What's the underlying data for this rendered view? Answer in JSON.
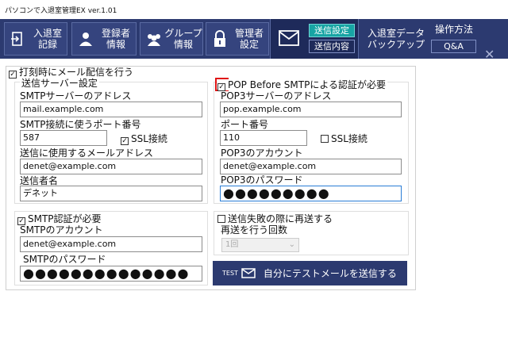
{
  "window": {
    "title": "パソコンで入退室管理EX ver.1.01"
  },
  "toolbar": {
    "buttons": [
      {
        "label": "入退室\n記録",
        "icon": "entry-record-icon"
      },
      {
        "label": "登録者\n情報",
        "icon": "user-icon"
      },
      {
        "label": "グループ\n情報",
        "icon": "group-icon"
      },
      {
        "label": "管理者\n設定",
        "icon": "lock-icon"
      }
    ],
    "mail_tab": {
      "send_settings": "送信設定",
      "send_content": "送信内容",
      "icon": "envelope-icon"
    },
    "backup": "入退室データ\nバックアップ",
    "help": "操作方法",
    "qa": "Q&A"
  },
  "form": {
    "send_mail_on_stamp": {
      "label": "打刻時にメール配信を行う",
      "checked": true
    },
    "server_section": {
      "title": "送信サーバー設定",
      "smtp_address_label": "SMTPサーバーのアドレス",
      "smtp_address": "mail.example.com",
      "smtp_port_label": "SMTP接続に使うポート番号",
      "smtp_port": "587",
      "smtp_ssl_label": "SSL接続",
      "smtp_ssl_checked": true,
      "sender_address_label": "送信に使用するメールアドレス",
      "sender_address": "denet@example.com",
      "sender_name_label": "送信者名",
      "sender_name": "デネット"
    },
    "pop_section": {
      "pop_before_smtp_label": "POP Before SMTPによる認証が必要",
      "pop_before_smtp_checked": true,
      "pop3_address_label": "POP3サーバーのアドレス",
      "pop3_address": "pop.example.com",
      "port_label": "ポート番号",
      "port": "110",
      "ssl_label": "SSL接続",
      "ssl_checked": false,
      "account_label": "POP3のアカウント",
      "account": "denet@example.com",
      "password_label": "POP3のパスワード",
      "password_mask": "●●●●●●●●●"
    },
    "smtp_auth_section": {
      "label": "SMTP認証が必要",
      "checked": true,
      "account_label": "SMTPのアカウント",
      "account": "denet@example.com",
      "password_label": "SMTPのパスワード",
      "password_mask": "●●●●●●●●●●●●●●"
    },
    "resend_section": {
      "label": "送信失敗の際に再送する",
      "checked": false,
      "count_label": "再送を行う回数",
      "count_value": "1回"
    },
    "test_button": {
      "prefix": "TEST",
      "label": "自分にテストメールを送信する",
      "icon": "envelope-icon"
    }
  }
}
